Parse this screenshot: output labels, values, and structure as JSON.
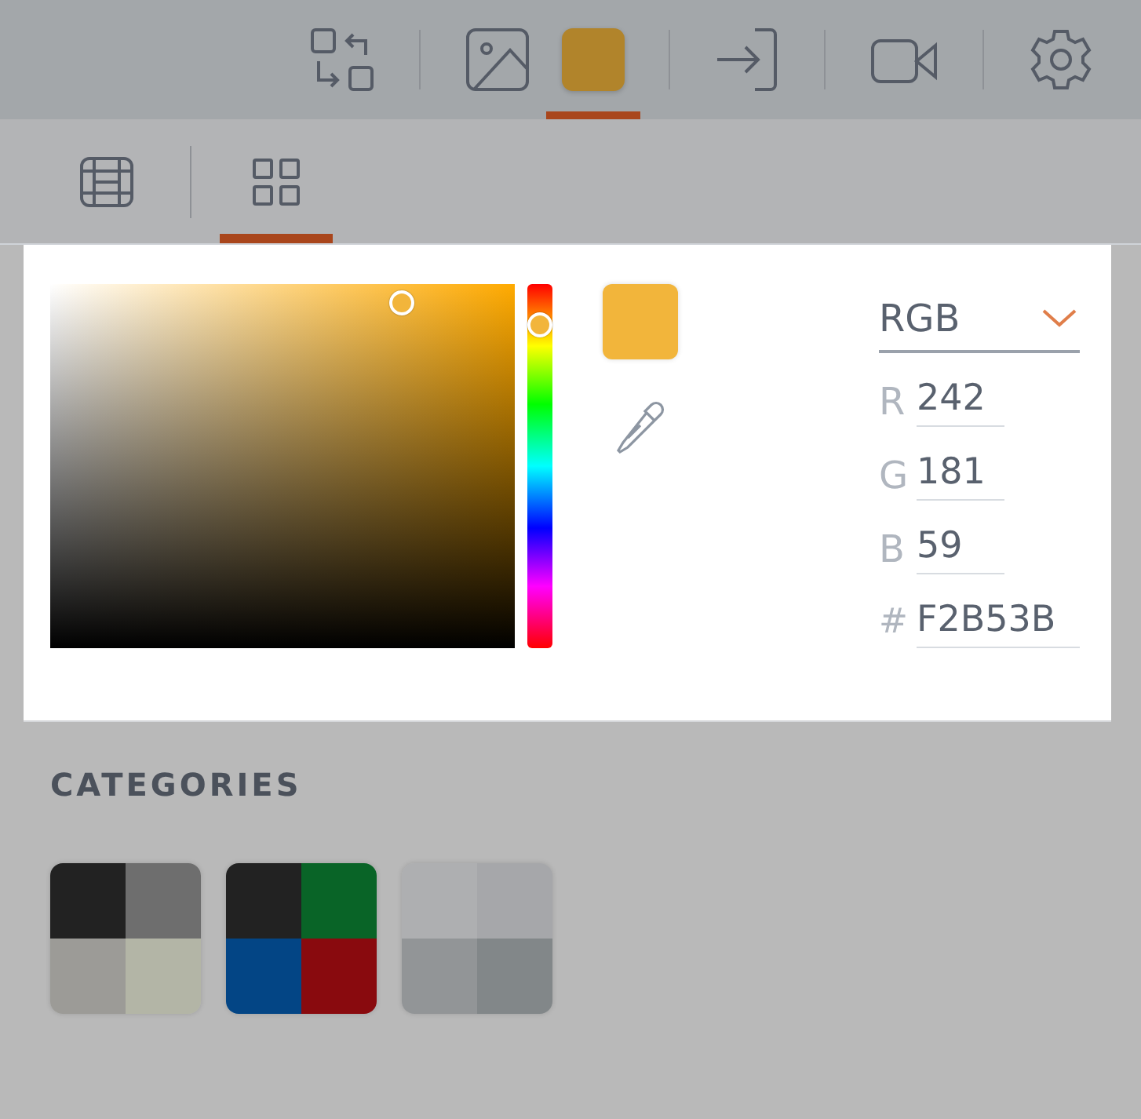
{
  "top_tab_groups": [
    [
      {
        "kind": "swap",
        "selected": false
      }
    ],
    [
      {
        "kind": "image",
        "selected": false
      },
      {
        "kind": "color",
        "selected": true
      }
    ],
    [
      {
        "kind": "signin",
        "selected": false
      }
    ],
    [
      {
        "kind": "video",
        "selected": false
      }
    ],
    [
      {
        "kind": "settings",
        "selected": false
      }
    ]
  ],
  "sub_tab_groups": [
    [
      {
        "kind": "table",
        "selected": false
      }
    ],
    [
      {
        "kind": "grid",
        "selected": true
      }
    ]
  ],
  "picker": {
    "mode": "RGB",
    "hex": {
      "label": "#",
      "value": "F2B53B"
    },
    "channels": [
      {
        "label": "R",
        "value": "242"
      },
      {
        "label": "G",
        "value": "181"
      },
      {
        "label": "B",
        "value": "59"
      }
    ]
  },
  "categories": {
    "title": "CATEGORIES",
    "items": [
      {
        "swatches": [
          {
            "color": "#222222"
          },
          {
            "color": "#6e6e6e"
          },
          {
            "color": "#9c9b97"
          },
          {
            "color": "#b3b5a6"
          }
        ]
      },
      {
        "swatches": [
          {
            "color": "#222222"
          },
          {
            "color": "#096427"
          },
          {
            "color": "#034585"
          },
          {
            "color": "#890a0e"
          }
        ]
      },
      {
        "swatches": [
          {
            "color": "#aeafb1"
          },
          {
            "color": "#a6a7aa"
          },
          {
            "color": "#929597"
          },
          {
            "color": "#828789"
          }
        ]
      }
    ]
  }
}
